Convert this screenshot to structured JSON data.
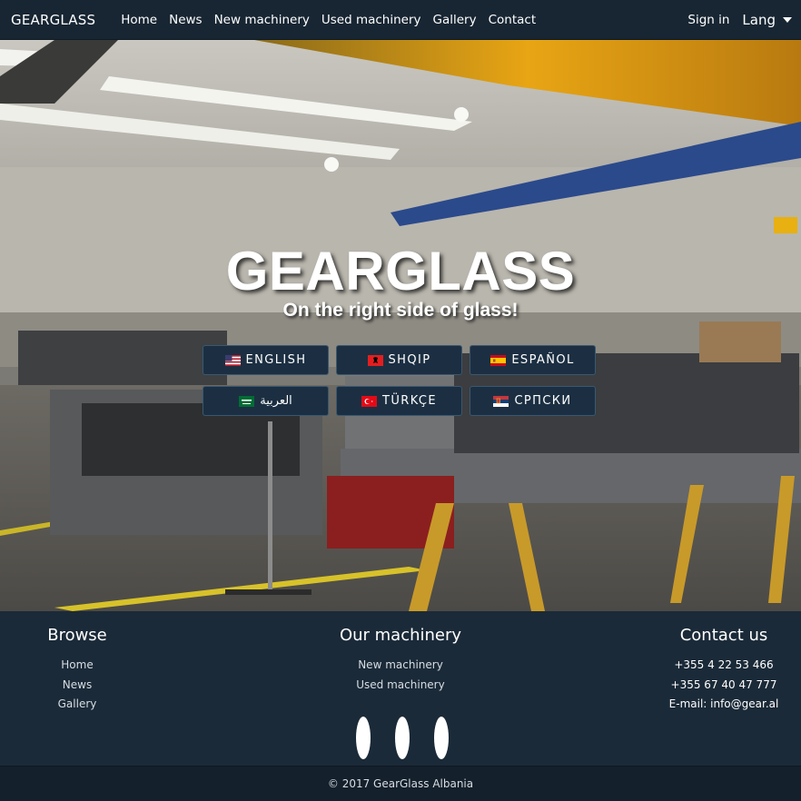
{
  "navbar": {
    "brand": "GEARGLASS",
    "links": [
      "Home",
      "News",
      "New machinery",
      "Used machinery",
      "Gallery",
      "Contact"
    ],
    "signin": "Sign in",
    "lang": "Lang"
  },
  "hero": {
    "title": "GEARGLASS",
    "subtitle": "On the right side of glass!",
    "languages": [
      {
        "label": "ENGLISH",
        "flag": "us-flag-icon"
      },
      {
        "label": "SHQIP",
        "flag": "albania-flag-icon"
      },
      {
        "label": "ESPAÑOL",
        "flag": "spain-flag-icon"
      },
      {
        "label": "العربية",
        "flag": "saudi-flag-icon"
      },
      {
        "label": "TÜRKÇE",
        "flag": "turkey-flag-icon"
      },
      {
        "label": "СРПСКИ",
        "flag": "serbia-flag-icon"
      }
    ]
  },
  "footer": {
    "browse": {
      "title": "Browse",
      "links": [
        "Home",
        "News",
        "Gallery"
      ]
    },
    "machinery": {
      "title": "Our machinery",
      "links": [
        "New machinery",
        "Used machinery"
      ]
    },
    "contact": {
      "title": "Contact us",
      "phone1": "+355 4 22 53 466",
      "phone2": "+355 67 40 47 777",
      "email": "E-mail: info@gear.al"
    },
    "copyright": "© 2017 GearGlass Albania"
  },
  "colors": {
    "navbar_bg": "#182633",
    "footer_bg": "#1b2a38",
    "button_bg": "#1c2f42",
    "button_border": "#3a5870"
  }
}
